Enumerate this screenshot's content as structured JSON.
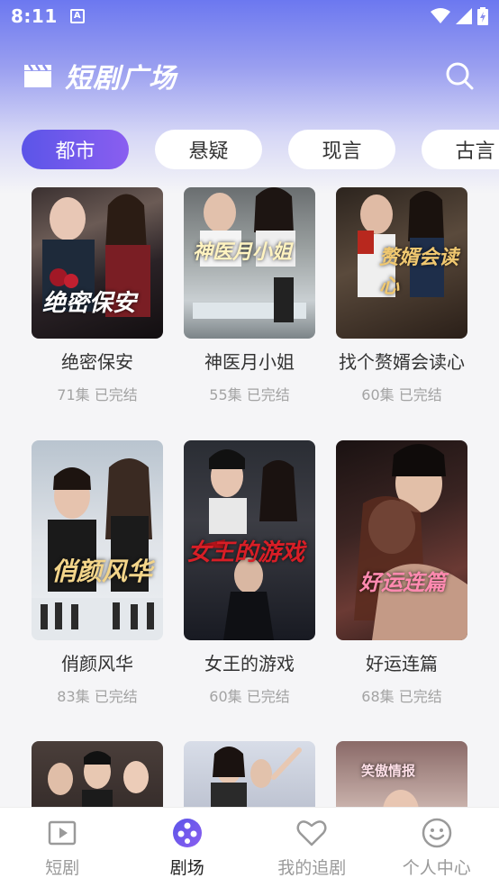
{
  "status_bar": {
    "time": "8:11"
  },
  "header": {
    "title": "短剧广场"
  },
  "tabs": [
    {
      "label": "都市",
      "active": true
    },
    {
      "label": "悬疑",
      "active": false
    },
    {
      "label": "现言",
      "active": false
    },
    {
      "label": "古言",
      "active": false
    }
  ],
  "dramas": [
    {
      "title": "绝密保安",
      "meta": "71集 已完结",
      "poster_text": "绝密保安"
    },
    {
      "title": "神医月小姐",
      "meta": "55集 已完结",
      "poster_text": "神医月小姐"
    },
    {
      "title": "找个赘婿会读心",
      "meta": "60集 已完结",
      "poster_text": "赘婿会读心"
    },
    {
      "title": "俏颜风华",
      "meta": "83集 已完结",
      "poster_text": "俏颜风华"
    },
    {
      "title": "女王的游戏",
      "meta": "60集 已完结",
      "poster_text": "女王的游戏"
    },
    {
      "title": "好运连篇",
      "meta": "68集 已完结",
      "poster_text": "好运连篇"
    },
    {
      "title": "",
      "meta": "",
      "poster_text": ""
    },
    {
      "title": "",
      "meta": "",
      "poster_text": ""
    },
    {
      "title": "",
      "meta": "",
      "poster_text": "笑傲情报"
    }
  ],
  "bottom_nav": [
    {
      "label": "短剧",
      "icon": "play-icon",
      "active": false
    },
    {
      "label": "剧场",
      "icon": "theater-icon",
      "active": true
    },
    {
      "label": "我的追剧",
      "icon": "heart-icon",
      "active": false
    },
    {
      "label": "个人中心",
      "icon": "smile-icon",
      "active": false
    }
  ],
  "colors": {
    "accent": "#5b55e8",
    "accent2": "#8a5ef0"
  }
}
